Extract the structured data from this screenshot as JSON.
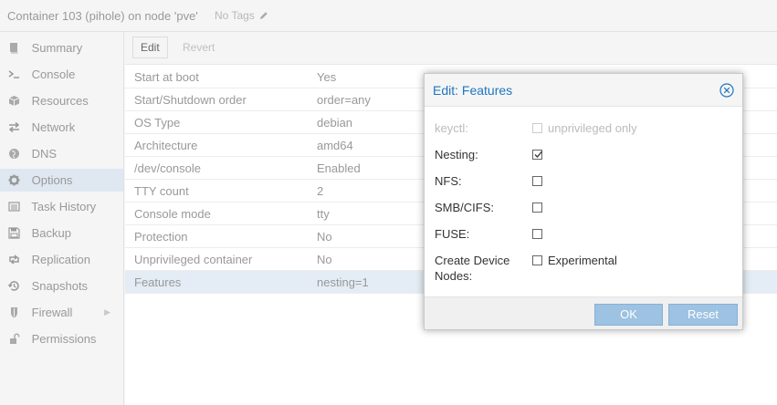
{
  "header": {
    "title": "Container 103 (pihole) on node 'pve'",
    "tags": "No Tags"
  },
  "sidebar": {
    "items": [
      {
        "label": "Summary",
        "icon": "book-icon"
      },
      {
        "label": "Console",
        "icon": "terminal-icon"
      },
      {
        "label": "Resources",
        "icon": "cube-icon"
      },
      {
        "label": "Network",
        "icon": "exchange-icon"
      },
      {
        "label": "DNS",
        "icon": "globe-icon"
      },
      {
        "label": "Options",
        "icon": "gear-icon",
        "selected": true
      },
      {
        "label": "Task History",
        "icon": "list-icon"
      },
      {
        "label": "Backup",
        "icon": "floppy-icon"
      },
      {
        "label": "Replication",
        "icon": "retweet-icon"
      },
      {
        "label": "Snapshots",
        "icon": "history-icon"
      },
      {
        "label": "Firewall",
        "icon": "shield-icon"
      },
      {
        "label": "Permissions",
        "icon": "unlock-icon"
      }
    ]
  },
  "toolbar": {
    "edit_label": "Edit",
    "revert_label": "Revert"
  },
  "options": {
    "rows": [
      {
        "key": "Start at boot",
        "value": "Yes"
      },
      {
        "key": "Start/Shutdown order",
        "value": "order=any"
      },
      {
        "key": "OS Type",
        "value": "debian"
      },
      {
        "key": "Architecture",
        "value": "amd64"
      },
      {
        "key": "/dev/console",
        "value": "Enabled"
      },
      {
        "key": "TTY count",
        "value": "2"
      },
      {
        "key": "Console mode",
        "value": "tty"
      },
      {
        "key": "Protection",
        "value": "No"
      },
      {
        "key": "Unprivileged container",
        "value": "No"
      },
      {
        "key": "Features",
        "value": "nesting=1",
        "selected": true
      }
    ]
  },
  "dialog": {
    "title": "Edit: Features",
    "fields": {
      "keyctl": {
        "label": "keyctl:",
        "box_label": "unprivileged only",
        "checked": false,
        "disabled": true
      },
      "nesting": {
        "label": "Nesting:",
        "checked": true
      },
      "nfs": {
        "label": "NFS:",
        "checked": false
      },
      "smb": {
        "label": "SMB/CIFS:",
        "checked": false
      },
      "fuse": {
        "label": "FUSE:",
        "checked": false
      },
      "mknod": {
        "label_line1": "Create Device",
        "label_line2": "Nodes:",
        "box_label": "Experimental",
        "checked": false
      }
    },
    "ok_label": "OK",
    "reset_label": "Reset"
  },
  "colors": {
    "accent": "#1e76c0",
    "button": "#9dc2e2",
    "selection": "#dfe8f1"
  }
}
